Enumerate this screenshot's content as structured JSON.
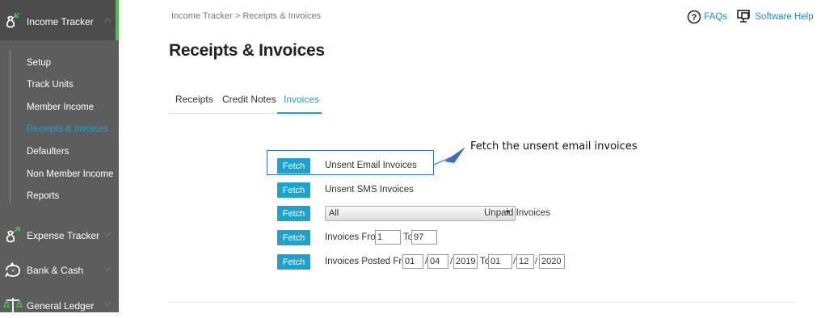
{
  "sidebar": {
    "sections": [
      {
        "label": "Income Tracker",
        "icon": "income-tracker-icon",
        "expanded": true
      },
      {
        "label": "Expense Tracker",
        "icon": "expense-tracker-icon"
      },
      {
        "label": "Bank & Cash",
        "icon": "bank-cash-icon"
      },
      {
        "label": "General Ledger",
        "icon": "general-ledger-icon"
      }
    ],
    "items": [
      {
        "label": "Setup"
      },
      {
        "label": "Track Units"
      },
      {
        "label": "Member Income"
      },
      {
        "label": "Receipts & Invoices",
        "selected": true
      },
      {
        "label": "Defaulters"
      },
      {
        "label": "Non Member Income"
      },
      {
        "label": "Reports"
      }
    ]
  },
  "header": {
    "breadcrumb": "Income Tracker > Receipts & Invoices",
    "faqs": "FAQs",
    "software_help": "Software Help"
  },
  "page": {
    "title": "Receipts & Invoices",
    "tabs": [
      {
        "label": "Receipts"
      },
      {
        "label": "Credit Notes"
      },
      {
        "label": "Invoices",
        "selected": true
      }
    ]
  },
  "actions": {
    "fetch_label": "Fetch",
    "unsent_email": "Unsent Email Invoices",
    "unsent_sms": "Unsent SMS Invoices",
    "unpaid_select_value": "All",
    "unpaid_label": "Unpaid Invoices",
    "invoices_from_label": "Invoices From",
    "invoices_from_value": "1",
    "to_label": "To",
    "invoices_to_value": "97",
    "posted_from_label": "Invoices Posted From",
    "posted_from": {
      "day": "01",
      "month": "04",
      "year": "2019"
    },
    "posted_to": {
      "day": "01",
      "month": "12",
      "year": "2020"
    },
    "slash": "/"
  },
  "annotation": {
    "text": "Fetch  the unsent email invoices"
  },
  "colors": {
    "accent": "#1aa3d1",
    "sidebar_bg": "#5d5d5d",
    "active_indicator": "#45c24a",
    "annotation": "#3a6fc4"
  }
}
